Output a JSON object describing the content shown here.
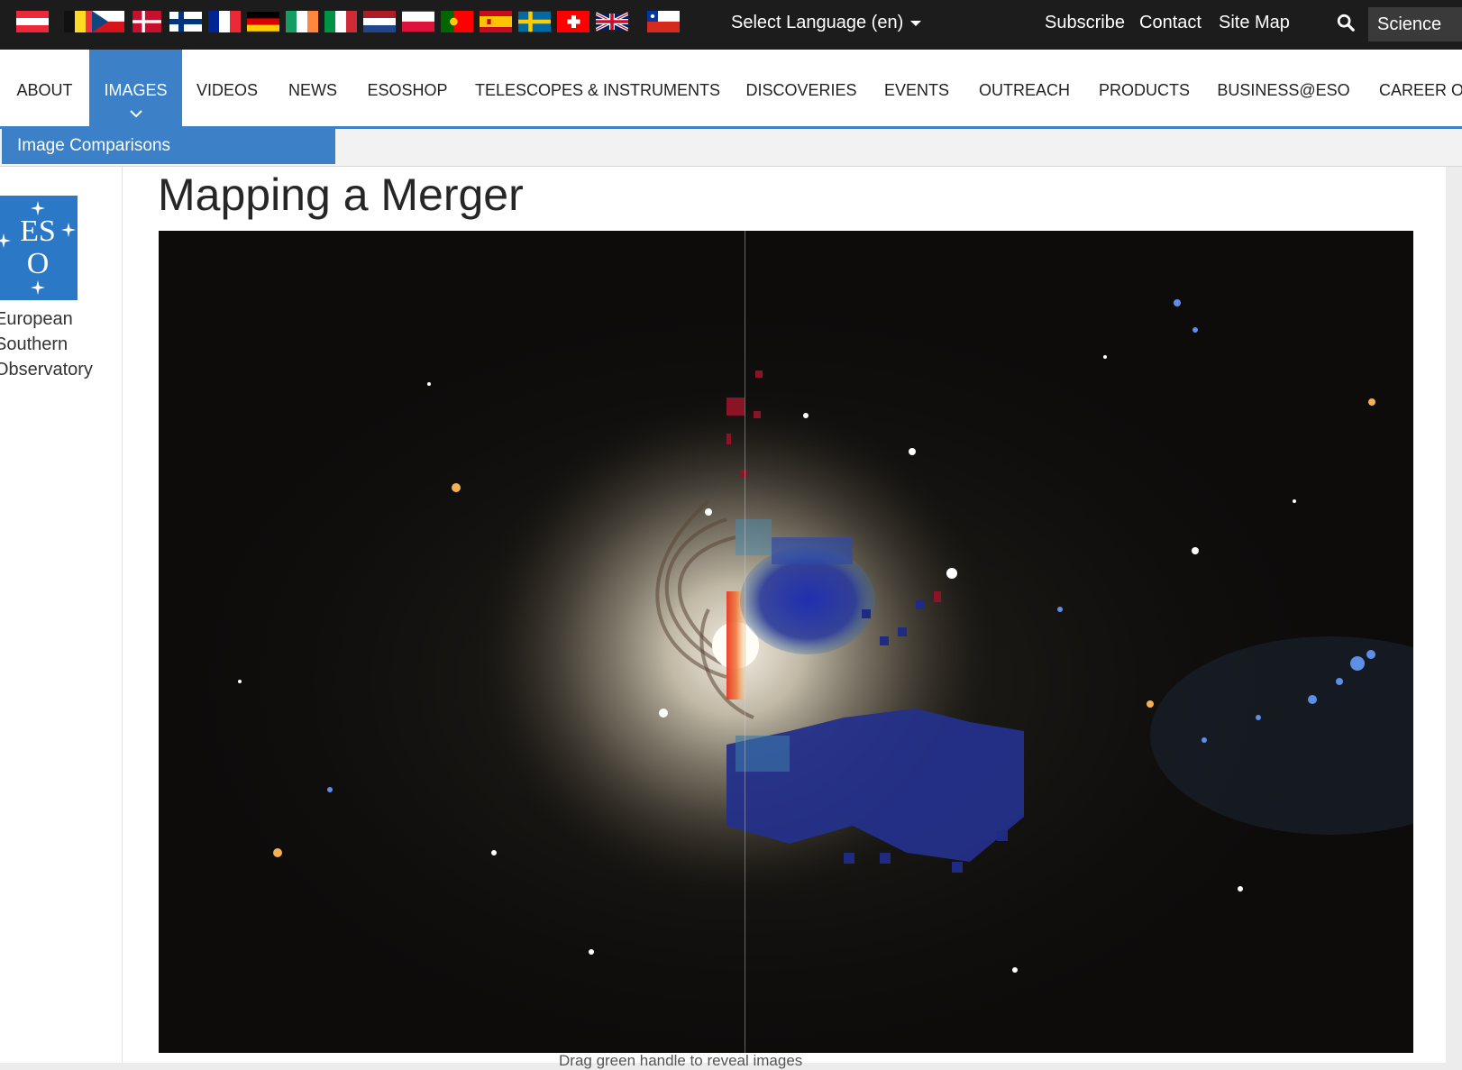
{
  "topbar": {
    "flags": [
      {
        "country": "Austria",
        "icon": "flag-austria-icon"
      },
      {
        "country": "Belgium",
        "icon": "flag-belgium-icon"
      },
      {
        "country": "Czechia",
        "icon": "flag-czechia-icon"
      },
      {
        "country": "Denmark",
        "icon": "flag-denmark-icon"
      },
      {
        "country": "Finland",
        "icon": "flag-finland-icon"
      },
      {
        "country": "France",
        "icon": "flag-france-icon"
      },
      {
        "country": "Germany",
        "icon": "flag-germany-icon"
      },
      {
        "country": "Ireland",
        "icon": "flag-ireland-icon"
      },
      {
        "country": "Italy",
        "icon": "flag-italy-icon"
      },
      {
        "country": "Netherlands",
        "icon": "flag-netherlands-icon"
      },
      {
        "country": "Poland",
        "icon": "flag-poland-icon"
      },
      {
        "country": "Portugal",
        "icon": "flag-portugal-icon"
      },
      {
        "country": "Spain",
        "icon": "flag-spain-icon"
      },
      {
        "country": "Sweden",
        "icon": "flag-sweden-icon"
      },
      {
        "country": "Switzerland",
        "icon": "flag-switzerland-icon"
      },
      {
        "country": "United Kingdom",
        "icon": "flag-uk-icon"
      },
      {
        "country": "Chile",
        "icon": "flag-chile-icon"
      }
    ],
    "language_label": "Select Language (en)",
    "links": {
      "subscribe": "Subscribe",
      "contact": "Contact",
      "sitemap": "Site Map"
    },
    "search_icon": "search-icon",
    "science_label": "Science"
  },
  "nav": {
    "items": [
      "ABOUT",
      "IMAGES",
      "VIDEOS",
      "NEWS",
      "ESOSHOP",
      "TELESCOPES & INSTRUMENTS",
      "DISCOVERIES",
      "EVENTS",
      "OUTREACH",
      "PRODUCTS",
      "BUSINESS@ESO",
      "CAREER OPPORTUNITIES"
    ],
    "active": "IMAGES"
  },
  "subnav": {
    "active_label": "Image Comparisons"
  },
  "sidebar": {
    "logo_text": "ESO",
    "org_lines": [
      "European",
      "Southern",
      "Observatory"
    ]
  },
  "main": {
    "title": "Mapping a Merger",
    "caption": "Drag green handle to reveal images",
    "slider_position_fraction": 0.467
  },
  "colors": {
    "accent": "#3c80c8",
    "topbar": "#1c1c1c",
    "overlay_blue": "#2c3aa0",
    "overlay_red": "#d8341c"
  }
}
